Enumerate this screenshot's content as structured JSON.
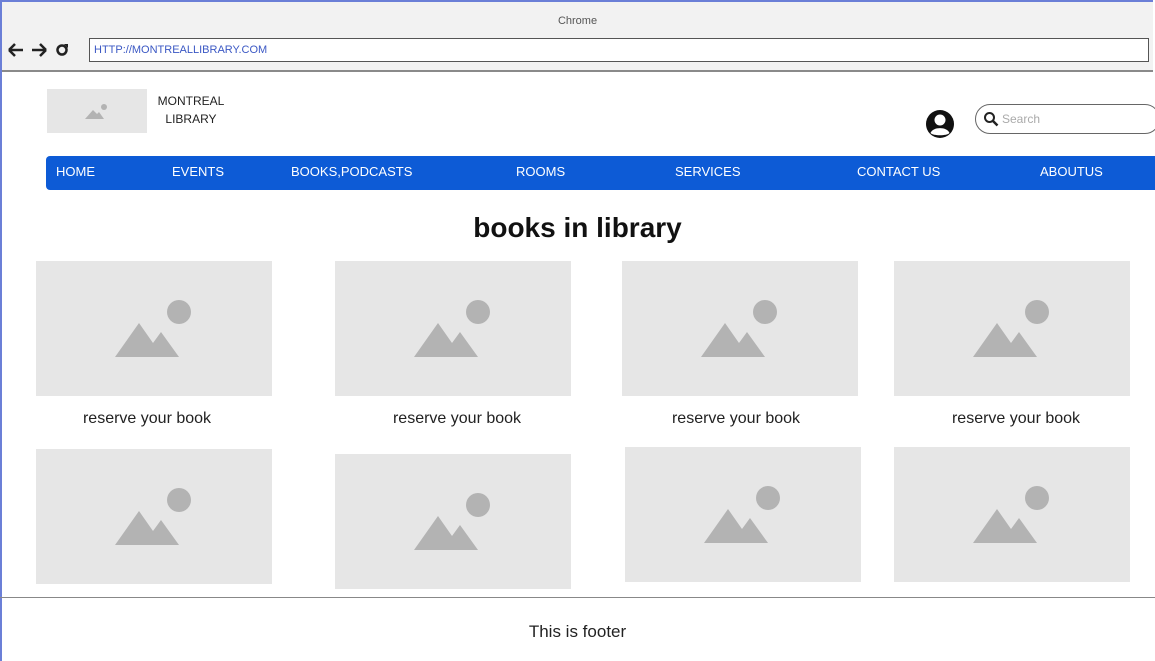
{
  "browser": {
    "title": "Chrome",
    "url": "HTTP://MONTREALLIBRARY.COM"
  },
  "header": {
    "logo_line1": "MONTREAL",
    "logo_line2": "LIBRARY",
    "search_placeholder": "Search"
  },
  "menu": {
    "items": [
      "HOME",
      "EVENTS",
      "BOOKS,PODCASTS",
      "ROOMS",
      "SERVICES",
      "CONTACT US",
      "ABOUTUS"
    ]
  },
  "main": {
    "heading": "books in library",
    "card_label": "reserve your book"
  },
  "footer": {
    "text": "This is footer"
  },
  "colors": {
    "menu_bg": "#0d5bd6",
    "placeholder_bg": "#e6e6e6",
    "placeholder_icon": "#b3b3b3"
  }
}
